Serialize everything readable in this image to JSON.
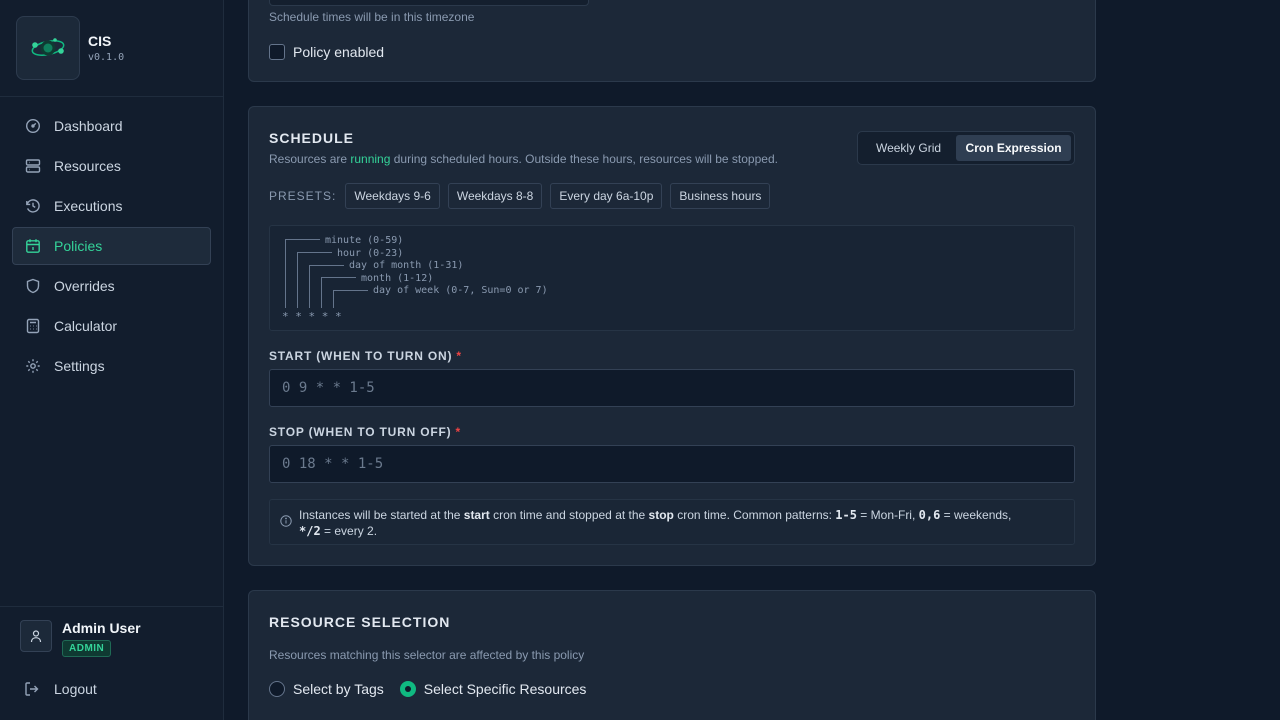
{
  "app": {
    "name": "CIS",
    "version": "v0.1.0"
  },
  "nav": [
    {
      "label": "Dashboard",
      "icon": "gauge-icon"
    },
    {
      "label": "Resources",
      "icon": "server-icon"
    },
    {
      "label": "Executions",
      "icon": "history-icon"
    },
    {
      "label": "Policies",
      "icon": "calendar-icon",
      "active": true
    },
    {
      "label": "Overrides",
      "icon": "shield-icon"
    },
    {
      "label": "Calculator",
      "icon": "calculator-icon"
    },
    {
      "label": "Settings",
      "icon": "gear-icon"
    }
  ],
  "user": {
    "name": "Admin User",
    "role": "ADMIN",
    "logout": "Logout"
  },
  "general": {
    "timezone_help": "Schedule times will be in this timezone",
    "policy_enabled_label": "Policy enabled"
  },
  "schedule": {
    "title": "SCHEDULE",
    "desc_before": "Resources are ",
    "desc_highlight": "running",
    "desc_after": " during scheduled hours. Outside these hours, resources will be stopped.",
    "mode_weekly": "Weekly Grid",
    "mode_cron": "Cron Expression",
    "presets_label": "PRESETS:",
    "presets": [
      "Weekdays 9-6",
      "Weekdays 8-8",
      "Every day 6a-10p",
      "Business hours"
    ],
    "cron_help": {
      "minute": "minute (0-59)",
      "hour": "hour (0-23)",
      "dom": "day of month (1-31)",
      "month": "month (1-12)",
      "dow": "day of week (0-7, Sun=0 or 7)",
      "stars": "* * * * *"
    },
    "start_label": "START (WHEN TO TURN ON)",
    "start_placeholder": "0 9 * * 1-5",
    "stop_label": "STOP (WHEN TO TURN OFF)",
    "stop_placeholder": "0 18 * * 1-5",
    "required_mark": "*",
    "info": {
      "t1": "Instances will be started at the ",
      "b1": "start",
      "t2": " cron time and stopped at the ",
      "b2": "stop",
      "t3": " cron time. Common patterns: ",
      "c1": "1-5",
      "t4": " = Mon-Fri, ",
      "c2": "0,6",
      "t5": " = weekends,",
      "c3": "*/2",
      "t6": " = every 2."
    }
  },
  "resource_selection": {
    "title": "RESOURCE SELECTION",
    "desc": "Resources matching this selector are affected by this policy",
    "by_tags": "Select by Tags",
    "specific": "Select Specific Resources"
  }
}
